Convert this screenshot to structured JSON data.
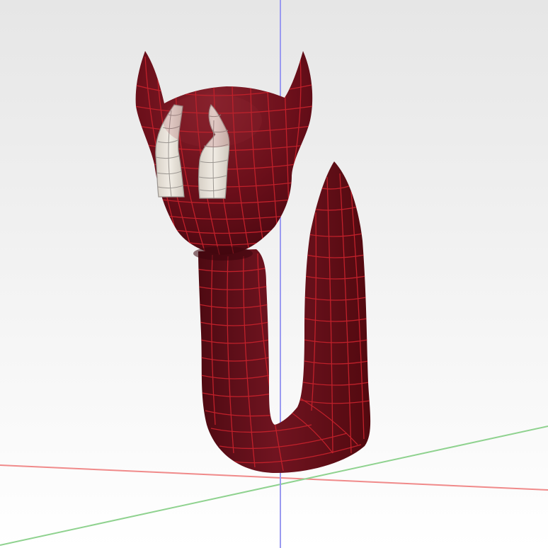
{
  "viewport": {
    "background_top": "#e6e6e6",
    "background_bottom": "#ffffff",
    "axis_colors": {
      "x": "#f08a8a",
      "y": "#8fd28f",
      "z": "#9a9af0"
    }
  },
  "model": {
    "body_color": "#6b0f1a",
    "body_shadow": "#4a0810",
    "body_highlight": "#8a2530",
    "wire_color": "#c0202a",
    "eye_color": "#e9e3da",
    "eye_wire_color": "#9a9590"
  }
}
